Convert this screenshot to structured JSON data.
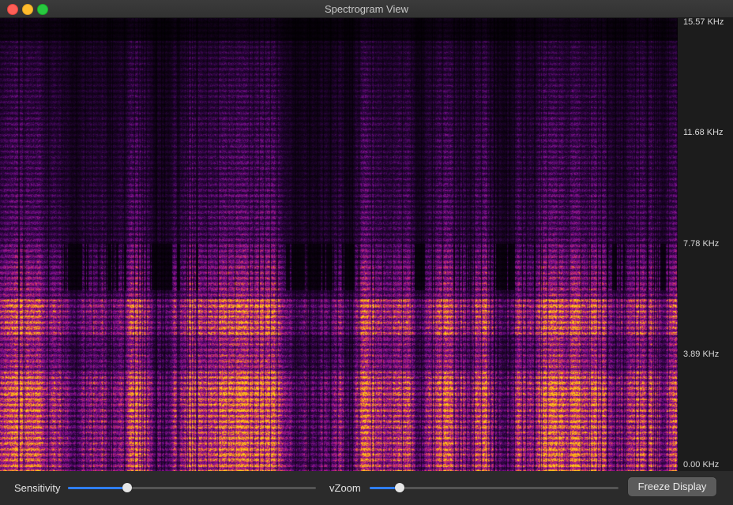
{
  "window": {
    "title": "Spectrogram View",
    "traffic_lights": {
      "close": "#fe5f57",
      "minimize": "#febc2e",
      "maximize": "#28c840"
    }
  },
  "spectrogram": {
    "colormap": [
      "#000000",
      "#2c0540",
      "#7a0f8f",
      "#c4247a",
      "#f08020",
      "#ffc51a"
    ],
    "frequency_axis": {
      "max_khz": 15.57,
      "ticks": [
        {
          "label": "15.57 KHz",
          "value": 15.57
        },
        {
          "label": "11.68 KHz",
          "value": 11.68
        },
        {
          "label": "7.78 KHz",
          "value": 7.78
        },
        {
          "label": "3.89 KHz",
          "value": 3.89
        },
        {
          "label": "0.00 KHz",
          "value": 0.0
        }
      ]
    }
  },
  "controls": {
    "sensitivity": {
      "label": "Sensitivity",
      "level": 0.24
    },
    "vzoom": {
      "label": "vZoom",
      "level": 0.12
    },
    "freeze_button": {
      "label": "Freeze Display"
    },
    "accent": "#2f7ef6"
  }
}
